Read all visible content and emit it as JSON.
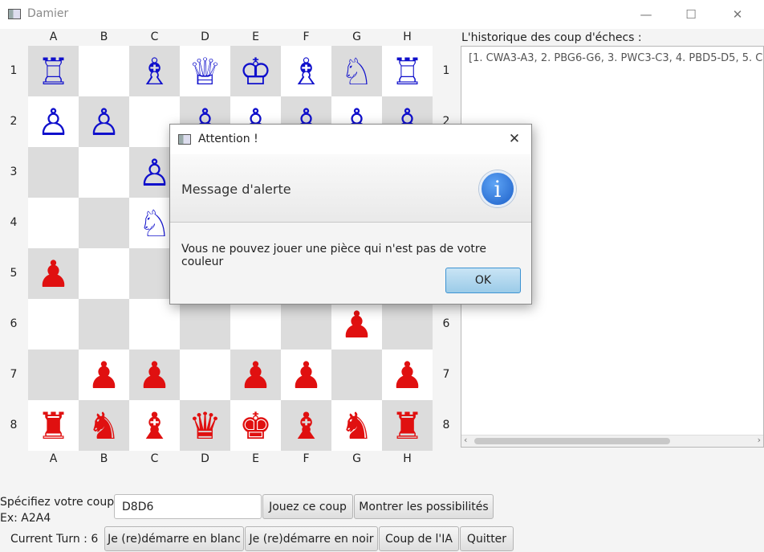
{
  "window": {
    "title": "Damier",
    "minimize_glyph": "—",
    "maximize_glyph": "☐",
    "close_glyph": "✕"
  },
  "board": {
    "columns": [
      "A",
      "B",
      "C",
      "D",
      "E",
      "F",
      "G",
      "H"
    ],
    "rows": [
      "1",
      "2",
      "3",
      "4",
      "5",
      "6",
      "7",
      "8"
    ],
    "light_color": "#ffffff",
    "dark_color": "#dcdcdc",
    "squares": [
      [
        {
          "p": "♖",
          "c": "blue"
        },
        {
          "p": "",
          "c": ""
        },
        {
          "p": "♗",
          "c": "blue"
        },
        {
          "p": "♕",
          "c": "blue"
        },
        {
          "p": "♔",
          "c": "blue"
        },
        {
          "p": "♗",
          "c": "blue"
        },
        {
          "p": "♘",
          "c": "blue"
        },
        {
          "p": "♖",
          "c": "blue"
        }
      ],
      [
        {
          "p": "♙",
          "c": "blue"
        },
        {
          "p": "♙",
          "c": "blue"
        },
        {
          "p": "",
          "c": ""
        },
        {
          "p": "♙",
          "c": "blue"
        },
        {
          "p": "♙",
          "c": "blue"
        },
        {
          "p": "♙",
          "c": "blue"
        },
        {
          "p": "♙",
          "c": "blue"
        },
        {
          "p": "♙",
          "c": "blue"
        }
      ],
      [
        {
          "p": "",
          "c": ""
        },
        {
          "p": "",
          "c": ""
        },
        {
          "p": "♙",
          "c": "blue"
        },
        {
          "p": "",
          "c": ""
        },
        {
          "p": "",
          "c": ""
        },
        {
          "p": "",
          "c": ""
        },
        {
          "p": "",
          "c": ""
        },
        {
          "p": "",
          "c": ""
        }
      ],
      [
        {
          "p": "",
          "c": ""
        },
        {
          "p": "",
          "c": ""
        },
        {
          "p": "♘",
          "c": "blue"
        },
        {
          "p": "",
          "c": ""
        },
        {
          "p": "",
          "c": ""
        },
        {
          "p": "",
          "c": ""
        },
        {
          "p": "",
          "c": ""
        },
        {
          "p": "",
          "c": ""
        }
      ],
      [
        {
          "p": "♟",
          "c": "red"
        },
        {
          "p": "",
          "c": ""
        },
        {
          "p": "",
          "c": ""
        },
        {
          "p": "",
          "c": ""
        },
        {
          "p": "",
          "c": ""
        },
        {
          "p": "",
          "c": ""
        },
        {
          "p": "",
          "c": ""
        },
        {
          "p": "",
          "c": ""
        }
      ],
      [
        {
          "p": "",
          "c": ""
        },
        {
          "p": "",
          "c": ""
        },
        {
          "p": "",
          "c": ""
        },
        {
          "p": "",
          "c": ""
        },
        {
          "p": "",
          "c": ""
        },
        {
          "p": "",
          "c": ""
        },
        {
          "p": "♟",
          "c": "red"
        },
        {
          "p": "",
          "c": ""
        }
      ],
      [
        {
          "p": "",
          "c": ""
        },
        {
          "p": "♟",
          "c": "red"
        },
        {
          "p": "♟",
          "c": "red"
        },
        {
          "p": "",
          "c": ""
        },
        {
          "p": "♟",
          "c": "red"
        },
        {
          "p": "♟",
          "c": "red"
        },
        {
          "p": "",
          "c": ""
        },
        {
          "p": "♟",
          "c": "red"
        }
      ],
      [
        {
          "p": "♜",
          "c": "red"
        },
        {
          "p": "♞",
          "c": "red"
        },
        {
          "p": "♝",
          "c": "red"
        },
        {
          "p": "♛",
          "c": "red"
        },
        {
          "p": "♚",
          "c": "red"
        },
        {
          "p": "♝",
          "c": "red"
        },
        {
          "p": "♞",
          "c": "red"
        },
        {
          "p": "♜",
          "c": "red"
        }
      ]
    ]
  },
  "history": {
    "label": "L'historique des coup d'échecs :",
    "text": "[1. CWA3-A3, 2. PBG6-G6, 3. PWC3-C3, 4. PBD5-D5, 5. C"
  },
  "controls": {
    "move_label": "Spécifiez votre coup :",
    "move_example": "Ex: A2A4",
    "move_value": "D8D6",
    "play_button": "Jouez ce coup",
    "show_button": "Montrer les possibilités",
    "turn_label": "Current Turn : 6",
    "restart_white": "Je (re)démarre en blanc",
    "restart_black": "Je (re)démarre en noir",
    "ai_move": "Coup de l'IA",
    "quit": "Quitter"
  },
  "dialog": {
    "title": "Attention !",
    "header": "Message d'alerte",
    "message": "Vous ne pouvez jouer une pièce qui n'est pas de votre couleur",
    "ok": "OK",
    "close_glyph": "✕",
    "icon_glyph": "i"
  }
}
